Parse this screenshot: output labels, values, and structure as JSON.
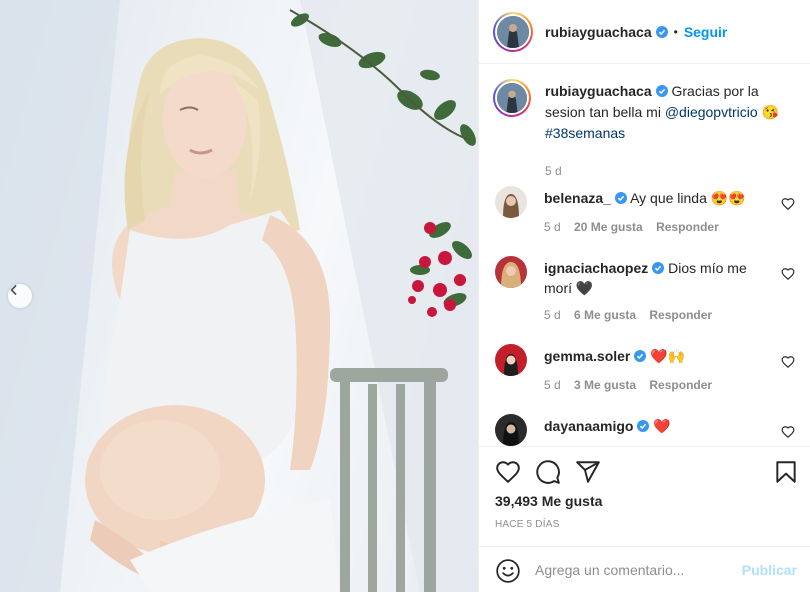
{
  "post": {
    "username": "rubiayguachaca",
    "follow_label": "Seguir",
    "separator": "•"
  },
  "caption": {
    "username": "rubiayguachaca",
    "text_1": "Gracias por la sesion tan bella mi ",
    "mention": "@diegopvtricio",
    "emoji": "😘",
    "hashtag": "#38semanas",
    "time": "5 d"
  },
  "comments": [
    {
      "username": "belenaza_",
      "text": "Ay que linda 😍😍",
      "time": "5 d",
      "likes": "20 Me gusta",
      "reply": "Responder"
    },
    {
      "username": "ignaciachaopez",
      "text": "Dios mío me morí 🖤",
      "time": "5 d",
      "likes": "6 Me gusta",
      "reply": "Responder"
    },
    {
      "username": "gemma.soler",
      "text": "❤️🙌",
      "time": "5 d",
      "likes": "3 Me gusta",
      "reply": "Responder"
    },
    {
      "username": "dayanaamigo",
      "text": "❤️"
    }
  ],
  "stats": {
    "likes": "39,493 Me gusta",
    "ago": "HACE 5 DÍAS"
  },
  "composer": {
    "placeholder": "Agrega un comentario...",
    "publish_label": "Publicar"
  },
  "icons": {
    "verified": "verified-badge-icon",
    "like": "heart-icon",
    "comment": "comment-bubble-icon",
    "share": "paper-plane-icon",
    "save": "bookmark-icon",
    "emoji": "smiley-icon",
    "prev": "chevron-left-icon"
  },
  "colors": {
    "link": "#00376b",
    "follow": "#0095f6",
    "muted": "#8e8e8e",
    "publish_disabled": "#b2dffc",
    "verified": "#3897f0"
  }
}
